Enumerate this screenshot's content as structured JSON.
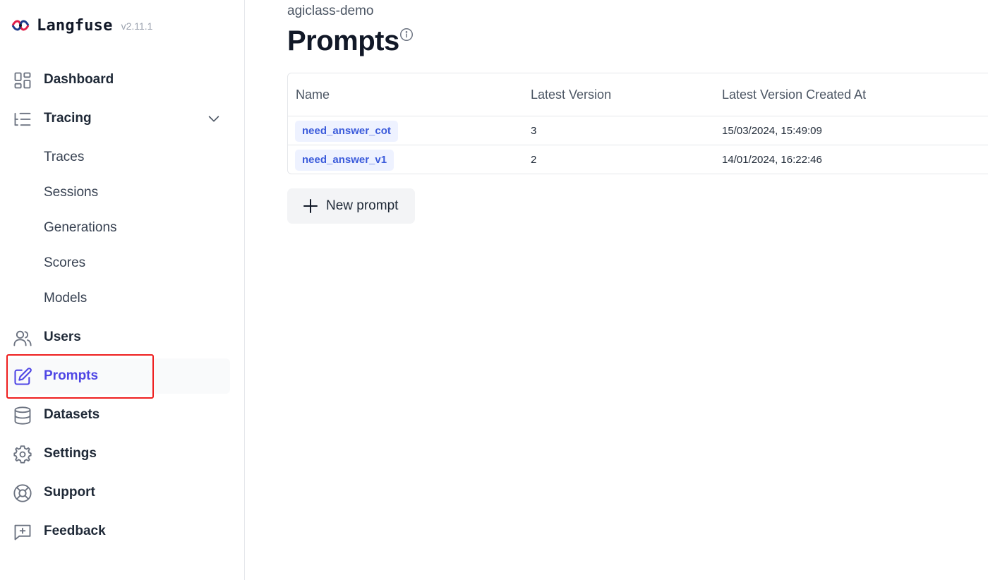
{
  "brand": {
    "name": "Langfuse",
    "version": "v2.11.1"
  },
  "sidebar": {
    "items": [
      {
        "label": "Dashboard",
        "icon": "dashboard-icon"
      },
      {
        "label": "Tracing",
        "icon": "tracing-icon",
        "expanded": true,
        "children": [
          "Traces",
          "Sessions",
          "Generations",
          "Scores",
          "Models"
        ]
      },
      {
        "label": "Users",
        "icon": "users-icon"
      },
      {
        "label": "Prompts",
        "icon": "pencil-square-icon",
        "active": true
      },
      {
        "label": "Datasets",
        "icon": "database-icon"
      },
      {
        "label": "Settings",
        "icon": "gear-icon"
      },
      {
        "label": "Support",
        "icon": "lifebuoy-icon"
      },
      {
        "label": "Feedback",
        "icon": "message-plus-icon"
      }
    ]
  },
  "header": {
    "project": "agiclass-demo",
    "title": "Prompts"
  },
  "table": {
    "columns": [
      "Name",
      "Latest Version",
      "Latest Version Created At"
    ],
    "rows": [
      {
        "name": "need_answer_cot",
        "version": "3",
        "created_at": "15/03/2024, 15:49:09"
      },
      {
        "name": "need_answer_v1",
        "version": "2",
        "created_at": "14/01/2024, 16:22:46"
      }
    ]
  },
  "actions": {
    "new_prompt_label": "New prompt"
  },
  "colors": {
    "accent": "#4f46e5",
    "chip_bg": "#eef2ff",
    "chip_text": "#3b5bdb",
    "highlight": "#ef1f1f"
  }
}
